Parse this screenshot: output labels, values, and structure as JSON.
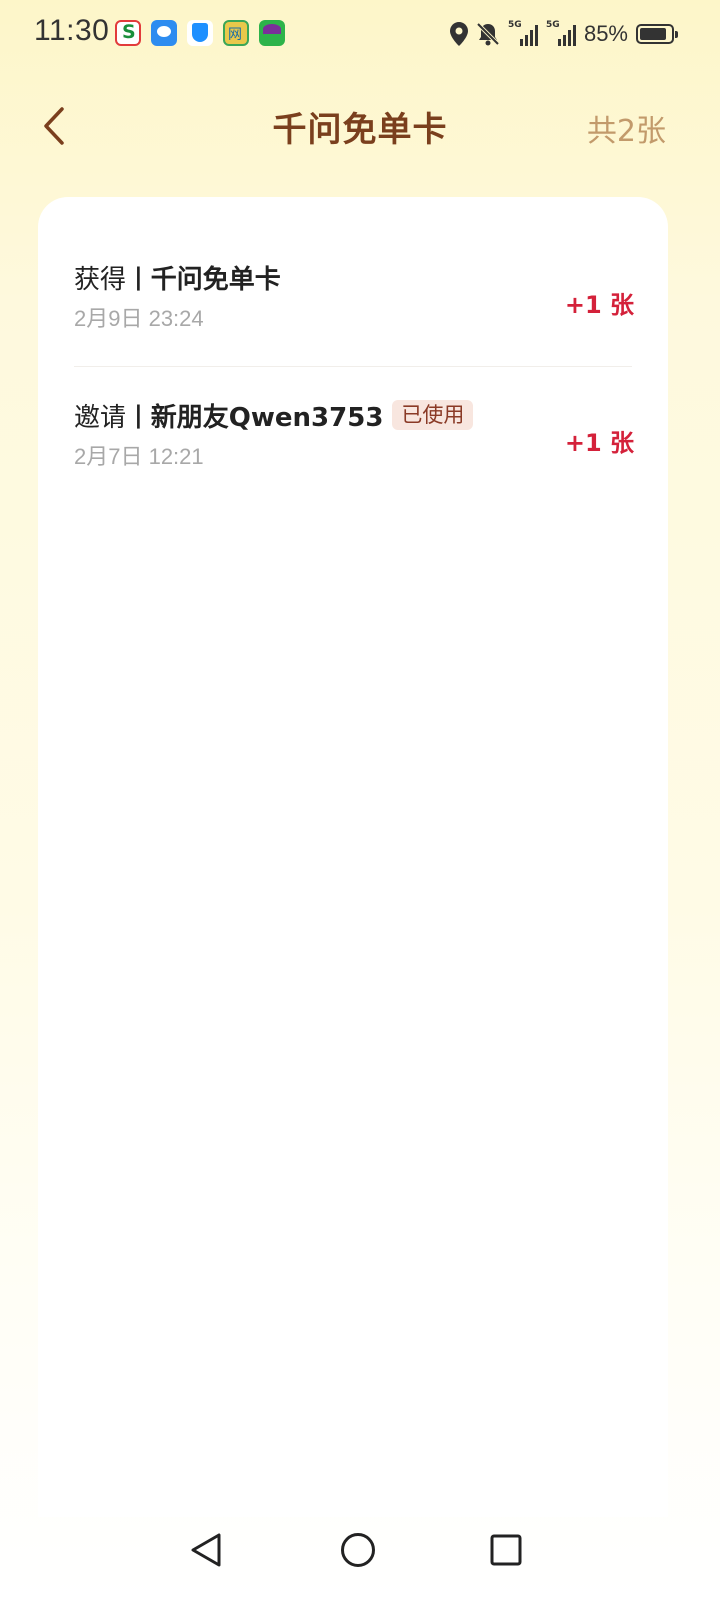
{
  "status_bar": {
    "time": "11:30",
    "notification_icons": [
      "china-mobile-icon",
      "messages-icon",
      "shield-app-icon",
      "news-app-icon",
      "shopping-app-icon"
    ],
    "system_icons": [
      "location-icon",
      "mute-icon",
      "signal-5g-icon",
      "signal-5g-icon"
    ],
    "signal_label": "5G",
    "battery_percent": "85%"
  },
  "header": {
    "back_icon": "chevron-left-icon",
    "title": "千问免单卡",
    "total_count": "共2张"
  },
  "records": [
    {
      "action": "获得",
      "separator": "|",
      "subject": "千问免单卡",
      "tag": "",
      "date": "2月9日 23:24",
      "amount": "+1 张"
    },
    {
      "action": "邀请",
      "separator": "|",
      "subject": "新朋友Qwen3753",
      "tag": "已使用",
      "date": "2月7日 12:21",
      "amount": "+1 张"
    }
  ],
  "nav_bar": {
    "back_icon": "triangle-back-icon",
    "home_icon": "circle-home-icon",
    "recents_icon": "square-recents-icon"
  },
  "colors": {
    "title": "#7a3f1d",
    "total_count": "#c29a6b",
    "amount": "#d4213a",
    "tag_bg": "#f8e6df",
    "tag_text": "#8a3a26"
  }
}
